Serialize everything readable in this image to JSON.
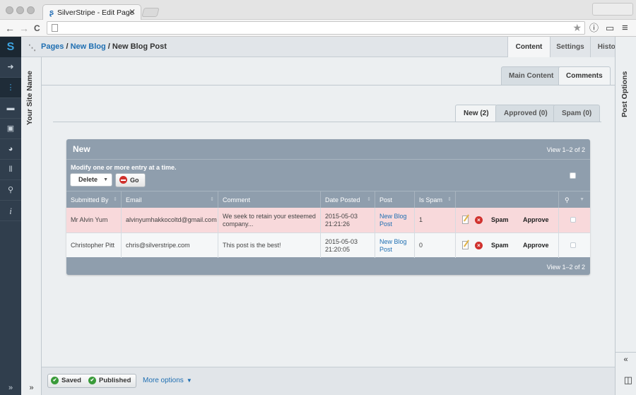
{
  "browser": {
    "tab_title": "SilverStripe - Edit Page",
    "tab_close": "✕",
    "back": "←",
    "forward": "→",
    "reload": "C",
    "star": "★",
    "info": "ⓘ",
    "cast": "▭",
    "menu": "≡"
  },
  "leftmenu": {
    "logo": "S",
    "items": [
      "➜",
      "⋮",
      "▬",
      "▣",
      "◕",
      "⦀",
      "⚲",
      "i"
    ],
    "collapse": "»"
  },
  "sitepanel": {
    "label": "Your Site Name",
    "collapse": "»"
  },
  "header": {
    "crumbs": [
      "Pages",
      "New Blog",
      "New Blog Post"
    ],
    "separator": "/",
    "tabs": [
      "Content",
      "Settings",
      "History"
    ]
  },
  "subtabs": [
    "Main Content",
    "Comments"
  ],
  "filtertabs": [
    "New (2)",
    "Approved (0)",
    "Spam (0)"
  ],
  "grid": {
    "title": "New",
    "count_top": "View 1–2 of 2",
    "count_bottom": "View 1–2 of 2",
    "bulk_message": "Modify one or more entry at a time.",
    "bulk_action": "Delete",
    "go_label": "Go",
    "columns": [
      "Submitted By",
      "Email",
      "Comment",
      "Date Posted",
      "Post",
      "Is Spam"
    ],
    "search_icon": "🔍",
    "rows": [
      {
        "submitted_by": "Mr Alvin Yum",
        "email": "alvinyumhakkocoltd@gmail.com",
        "comment": "We seek to retain your esteemed company...",
        "date": "2015-05-03 21:21:26",
        "post": "New Blog Post",
        "is_spam": "1",
        "spam_label": "Spam",
        "approve_label": "Approve"
      },
      {
        "submitted_by": "Christopher Pitt",
        "email": "chris@silverstripe.com",
        "comment": "This post is the best!",
        "date": "2015-05-03 21:20:05",
        "post": "New Blog Post",
        "is_spam": "0",
        "spam_label": "Spam",
        "approve_label": "Approve"
      }
    ]
  },
  "rightpanel": {
    "label": "Post Options",
    "collapse": "«"
  },
  "bottombar": {
    "saved": "Saved",
    "published": "Published",
    "more_options": "More options",
    "preview_icon": "◫"
  }
}
